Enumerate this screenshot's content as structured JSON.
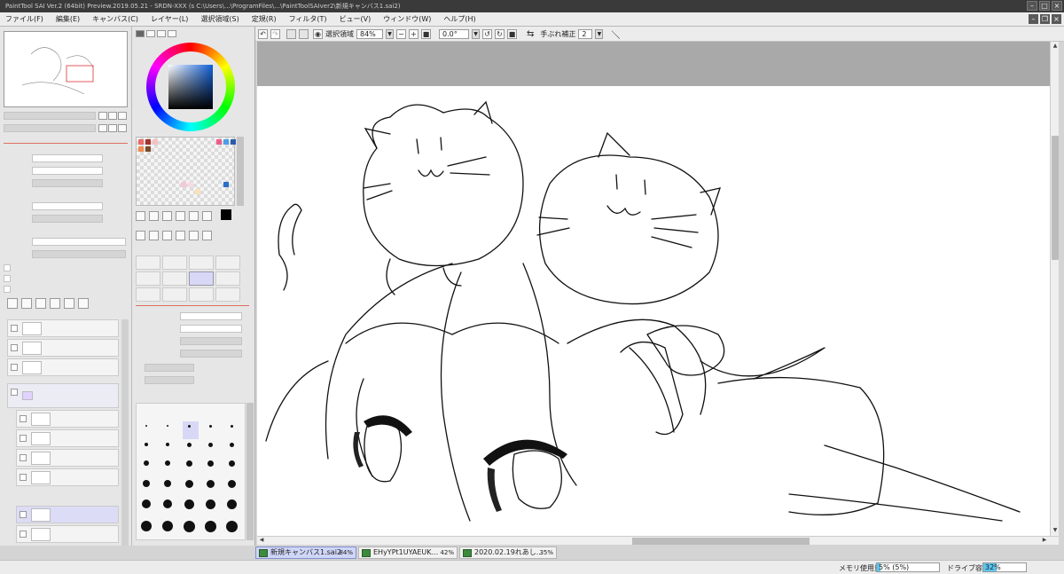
{
  "app": {
    "title": "PaintTool SAI Ver.2 (64bit) Preview.2019.05.21 - SRDN-XXX (s C:\\Users\\...\\ProgramFiles\\...\\PaintToolSAIver2\\新規キャンバス1.sai2)"
  },
  "menu": [
    "ファイル(F)",
    "編集(E)",
    "キャンバス(C)",
    "レイヤー(L)",
    "選択領域(S)",
    "定規(R)",
    "フィルタ(T)",
    "ビュー(V)",
    "ウィンドウ(W)",
    "ヘルプ(H)"
  ],
  "toolbar": {
    "selection_label": "選択領域",
    "zoom": "84%",
    "rotation": "0.0°",
    "stabilizer_label": "手ぶれ補正",
    "stabilizer_value": "2"
  },
  "tabs": [
    {
      "name": "新規キャンバス1.sai2",
      "zoom": "84%",
      "active": true
    },
    {
      "name": "EHyYPt1UYAEUK...",
      "zoom": "42%",
      "active": false
    },
    {
      "name": "2020.02.19れあし...",
      "zoom": "35%",
      "active": false
    }
  ],
  "status": {
    "memory_label": "メモリ使用量",
    "memory_value": "5% (5%)",
    "memory_fraction": 0.05,
    "drive_label": "ドライブ容量",
    "drive_value": "32%",
    "drive_fraction": 0.32
  },
  "colors": {
    "canvas_gray": "#a9a9a9",
    "tab_active": "#cfd6f7",
    "drive_fill": "#5bc6f0"
  }
}
